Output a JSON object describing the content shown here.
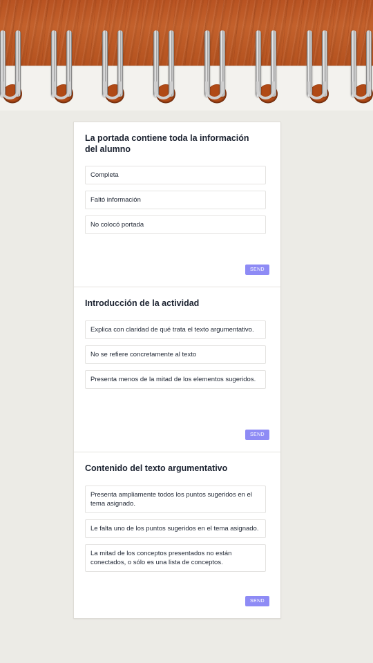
{
  "questions": [
    {
      "title": "La portada contiene toda la información del alumno",
      "options": [
        "Completa",
        "Faltó información",
        "No colocó portada"
      ],
      "send_label": "SEND"
    },
    {
      "title": "Introducción de la actividad",
      "options": [
        "Explica con claridad de qué trata el texto argumentativo.",
        "No se refiere concretamente al texto",
        "Presenta menos de la mitad de los elementos sugeridos."
      ],
      "send_label": "SEND"
    },
    {
      "title": "Contenido del texto argumentativo",
      "options": [
        "Presenta ampliamente todos los puntos sugeridos en el tema asignado.",
        "Le falta uno de los puntos sugeridos en el tema asignado.",
        "La mitad de los conceptos presentados no están conectados, o sólo es una lista de conceptos."
      ],
      "send_label": "SEND"
    }
  ],
  "colors": {
    "send_button": "#8e8bf5",
    "wood": "#c3612c",
    "page_background": "#ecebe6"
  },
  "icons": [
    "notebook-spiral-ring"
  ]
}
